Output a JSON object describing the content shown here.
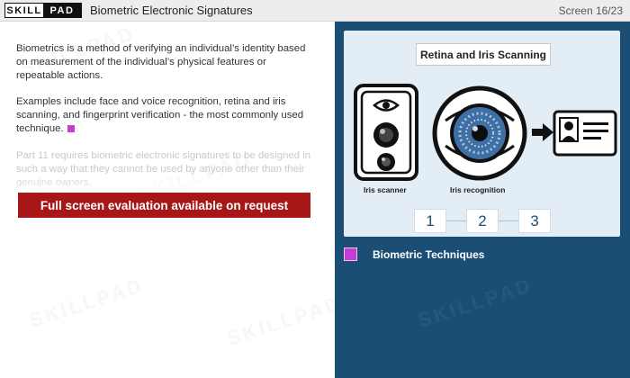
{
  "header": {
    "logo_left": "SKILL",
    "logo_right": "PAD",
    "title": "Biometric Electronic Signatures",
    "screen_counter": "Screen 16/23"
  },
  "content": {
    "paragraph1": "Biometrics is a method of verifying an individual’s identity based on measurement of the individual’s physical features or repeatable actions.",
    "paragraph2": "Examples include face and voice recognition, retina and iris scanning, and fingerprint verification - the most commonly used technique.",
    "paragraph3": "Part 11 requires biometric electronic signatures to be designed in such a way that they cannot be used by anyone other than their genuine owners.",
    "cta_label": "Full screen evaluation available on request"
  },
  "illustration": {
    "title": "Retina and Iris Scanning",
    "caption_scanner": "Iris scanner",
    "caption_recognition": "Iris recognition",
    "steps": [
      "1",
      "2",
      "3"
    ]
  },
  "panel": {
    "section_label": "Biometric Techniques"
  },
  "watermark": "SKILLPAD",
  "colors": {
    "header_bg": "#ededed",
    "cta_bg": "#a81717",
    "panel_bg": "#1a4e74",
    "illustration_bg": "#e2edf6",
    "accent_magenta": "#c23fd2"
  }
}
